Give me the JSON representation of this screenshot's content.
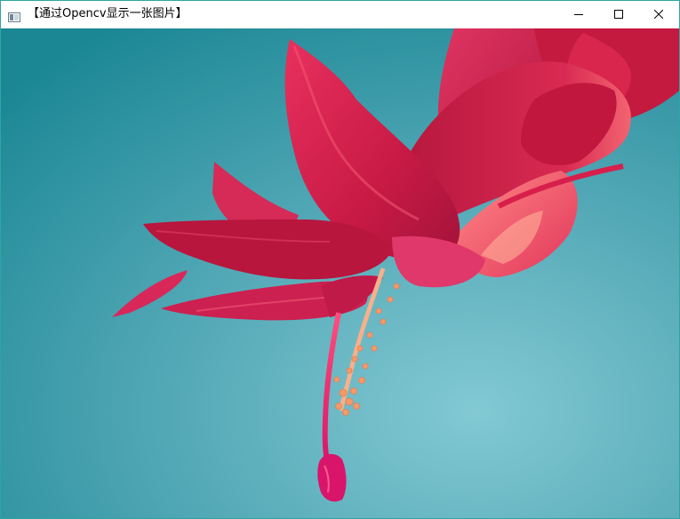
{
  "window": {
    "title": "【通过Opencv显示一张图片】",
    "controls": {
      "minimize": "minimize-icon",
      "maximize": "maximize-icon",
      "close": "close-icon"
    }
  },
  "image": {
    "subject": "red-pink flower",
    "colors": {
      "background_dark": "#1e8a96",
      "background_light": "#7cc6d1",
      "petal_main": "#d8234f",
      "petal_highlight": "#f36b73",
      "stamen": "#f39b6a",
      "pistil": "#e11e6a"
    }
  }
}
